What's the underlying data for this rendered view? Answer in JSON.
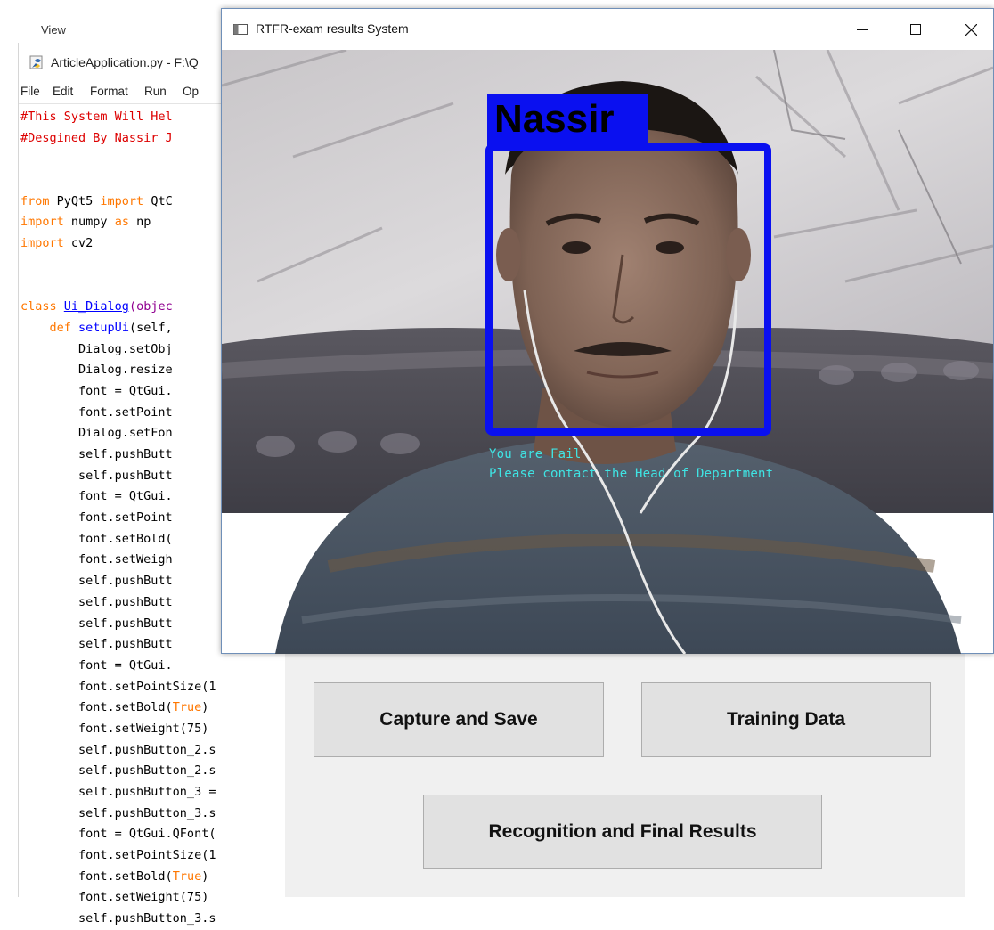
{
  "background_app": {
    "menu_view_label": "View"
  },
  "editor": {
    "title": "ArticleApplication.py - F:\\Q",
    "menu": [
      "File",
      "Edit",
      "Format",
      "Run",
      "Op"
    ],
    "code_lines": [
      [
        {
          "t": "#This System Will Hel",
          "c": "cm"
        }
      ],
      [
        {
          "t": "#Desgined By Nassir J",
          "c": "cm"
        }
      ],
      [],
      [],
      [
        {
          "t": "from",
          "c": "kw"
        },
        {
          "t": " PyQt5 "
        },
        {
          "t": "import",
          "c": "kw"
        },
        {
          "t": " QtC"
        }
      ],
      [
        {
          "t": "import",
          "c": "kw"
        },
        {
          "t": " numpy "
        },
        {
          "t": "as",
          "c": "kw"
        },
        {
          "t": " np"
        }
      ],
      [
        {
          "t": "import",
          "c": "kw"
        },
        {
          "t": " cv2"
        }
      ],
      [],
      [],
      [
        {
          "t": "class",
          "c": "kw"
        },
        {
          "t": " "
        },
        {
          "t": "Ui_Dialog",
          "c": "df ul"
        },
        {
          "t": "(objec",
          "c": "bi"
        }
      ],
      [
        {
          "t": "    "
        },
        {
          "t": "def",
          "c": "kw"
        },
        {
          "t": " "
        },
        {
          "t": "setupUi",
          "c": "df"
        },
        {
          "t": "(self,"
        }
      ],
      [
        {
          "t": "        Dialog.setObj"
        }
      ],
      [
        {
          "t": "        Dialog.resize"
        }
      ],
      [
        {
          "t": "        font = QtGui."
        }
      ],
      [
        {
          "t": "        font.setPoint"
        }
      ],
      [
        {
          "t": "        Dialog.setFon"
        }
      ],
      [
        {
          "t": "        self.pushButt"
        }
      ],
      [
        {
          "t": "        self.pushButt"
        }
      ],
      [
        {
          "t": "        font = QtGui."
        }
      ],
      [
        {
          "t": "        font.setPoint"
        }
      ],
      [
        {
          "t": "        font.setBold("
        }
      ],
      [
        {
          "t": "        font.setWeigh"
        }
      ],
      [
        {
          "t": "        self.pushButt"
        }
      ],
      [
        {
          "t": "        self.pushButt"
        }
      ],
      [
        {
          "t": "        self.pushButt"
        }
      ],
      [
        {
          "t": "        self.pushButt"
        }
      ],
      [
        {
          "t": "        font = QtGui."
        }
      ],
      [
        {
          "t": "        font.setPointSize(1"
        }
      ],
      [
        {
          "t": "        font.setBold("
        },
        {
          "t": "True",
          "c": "bo"
        },
        {
          "t": ")"
        }
      ],
      [
        {
          "t": "        font.setWeight(75)"
        }
      ],
      [
        {
          "t": "        self.pushButton_2.s"
        }
      ],
      [
        {
          "t": "        self.pushButton_2.s"
        }
      ],
      [
        {
          "t": "        self.pushButton_3 ="
        }
      ],
      [
        {
          "t": "        self.pushButton_3.s"
        }
      ],
      [
        {
          "t": "        font = QtGui.QFont("
        }
      ],
      [
        {
          "t": "        font.setPointSize(1"
        }
      ],
      [
        {
          "t": "        font.setBold("
        },
        {
          "t": "True",
          "c": "bo"
        },
        {
          "t": ")"
        }
      ],
      [
        {
          "t": "        font.setWeight(75)"
        }
      ],
      [
        {
          "t": "        self.pushButton_3.s"
        }
      ]
    ]
  },
  "dialog": {
    "capture_label": "Capture and Save",
    "training_label": "Training Data",
    "recognition_label": "Recognition and Final Results"
  },
  "camera_window": {
    "title": "RTFR-exam results System",
    "minimize_icon": "minimize-icon",
    "maximize_icon": "maximize-icon",
    "close_icon": "close-icon",
    "detected_name": "Nassir",
    "status_line1": "You are Fail",
    "status_line2": "Please contact the Head of Department",
    "box_color": "#0a10f0",
    "overlay_text_color": "#3fe4e4"
  }
}
